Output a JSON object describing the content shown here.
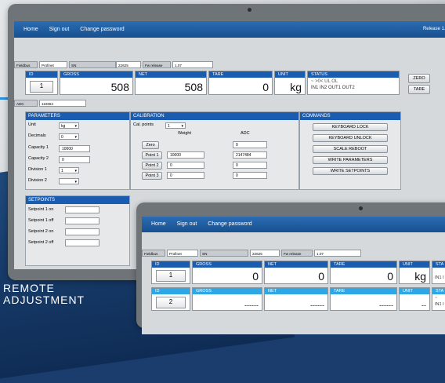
{
  "caption": {
    "line1": "REMOTE",
    "line2": "ADJUSTMENT"
  },
  "nav": {
    "home": "Home",
    "signout": "Sign out",
    "change_password": "Change password",
    "release": "Release 1.0"
  },
  "info": {
    "fieldbus_label": "Fieldbus",
    "fieldbus_value": "Profinet",
    "sn_label": "SN",
    "sn_value": "22625",
    "fw_label": "Fw release",
    "fw_value": "1.07",
    "adc_label": "ADC",
    "adc_value": "110664"
  },
  "status_row": {
    "id_label": "ID",
    "id_value": "1",
    "gross_label": "GROSS",
    "gross_value": "508",
    "net_label": "NET",
    "net_value": "508",
    "tare_label": "TARE",
    "tare_value": "0",
    "unit_label": "UNIT",
    "unit_value": "kg",
    "status_label": "STATUS",
    "status_top": "~  >0<  UL   OL",
    "status_bottom": "IN1 IN2 OUT1 OUT2",
    "zero_button": "ZERO",
    "tare_button": "TARE"
  },
  "parameters": {
    "title": "PARAMETERS",
    "unit_label": "Unit",
    "unit_value": "kg",
    "decimals_label": "Decimals",
    "decimals_value": "0",
    "capacity1_label": "Capacity 1",
    "capacity1_value": "10000",
    "capacity2_label": "Capacity 2",
    "capacity2_value": "0",
    "division1_label": "Division 1",
    "division1_value": "1",
    "division2_label": "Division 2",
    "division2_value": ""
  },
  "calibration": {
    "title": "CALIBRATION",
    "cal_points_label": "Cal. points",
    "cal_points_value": "1",
    "weight_header": "Weight",
    "adc_header": "ADC",
    "zero_button": "Zero",
    "zero_adc": "0",
    "point1_button": "Point 1",
    "point1_weight": "10000",
    "point1_adc": "2147484",
    "point2_button": "Point 2",
    "point2_weight": "0",
    "point2_adc": "0",
    "point3_button": "Point 3",
    "point3_weight": "0",
    "point3_adc": "0"
  },
  "commands": {
    "title": "COMMANDS",
    "keyboard_lock": "KEYBOARD LOCK",
    "keyboard_unlock": "KEYBOARD UNLOCK",
    "scale_reboot": "SCALE REBOOT",
    "write_parameters": "WRITE PARAMETERS",
    "write_setpoints": "WRITE SETPOINTS"
  },
  "setpoints": {
    "title": "SETPOINTS",
    "sp1_on": "Setpoint 1 on",
    "sp1_off": "Setpoint 1 off",
    "sp2_on": "Setpoint 2 on",
    "sp2_off": "Setpoint 2 off"
  },
  "tablet2": {
    "nav": {
      "home": "Home",
      "signout": "Sign out",
      "change_password": "Change password"
    },
    "info": {
      "fieldbus_label": "Fieldbus",
      "fieldbus_value": "Profinet",
      "sn_label": "SN",
      "sn_value": "22625",
      "fw_label": "Fw release",
      "fw_value": "1.07"
    },
    "row1": {
      "id_label": "ID",
      "id_value": "1",
      "gross_label": "GROSS",
      "gross_value": "0",
      "net_label": "NET",
      "net_value": "0",
      "tare_label": "TARE",
      "tare_value": "0",
      "unit_label": "UNIT",
      "unit_value": "kg",
      "status_label": "STA",
      "status_bottom": "IN1 I"
    },
    "row2": {
      "id_label": "ID",
      "id_value": "2",
      "gross_label": "GROSS",
      "gross_value": "------",
      "net_label": "NET",
      "net_value": "------",
      "tare_label": "TARE",
      "tare_value": "------",
      "unit_label": "UNIT",
      "unit_value": "--",
      "status_label": "STA",
      "status_top": "~",
      "status_bottom": "IN1 I"
    }
  }
}
